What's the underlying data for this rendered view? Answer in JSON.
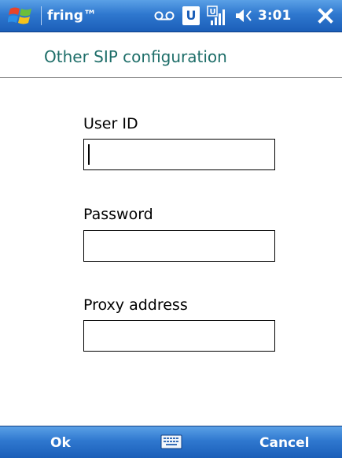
{
  "status_bar": {
    "app_name": "fring™",
    "time": "3:01",
    "badge_letter": "U",
    "icons": [
      "windows-start-icon",
      "voicemail-icon",
      "signal-strength-icon",
      "speaker-icon",
      "close-icon"
    ]
  },
  "page": {
    "title": "Other SIP configuration"
  },
  "form": {
    "user_id": {
      "label": "User ID",
      "value": ""
    },
    "password": {
      "label": "Password",
      "value": ""
    },
    "proxy_address": {
      "label": "Proxy address",
      "value": ""
    }
  },
  "softkeys": {
    "left": "Ok",
    "right": "Cancel",
    "center_icon": "keyboard-icon"
  },
  "colors": {
    "bar_blue": "#2f78cf",
    "title_teal": "#1e6e69"
  }
}
